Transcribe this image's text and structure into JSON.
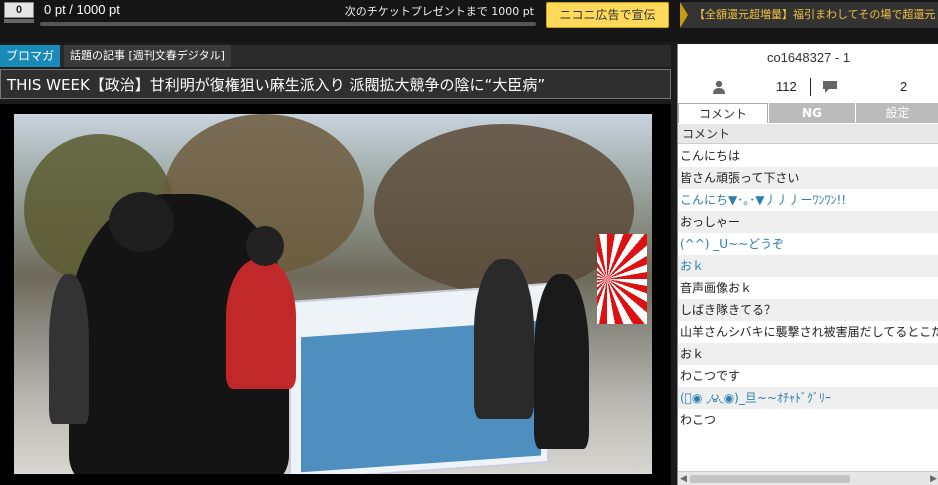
{
  "points": {
    "badge": "0",
    "status": "0 pt / 1000 pt",
    "next_ticket": "次のチケットプレゼントまで 1000 pt",
    "progress": 0
  },
  "ad_button": "ニコニ広告で宣伝",
  "ticker": "【全額還元超増量】福引まわしてその場で超還元",
  "tags": {
    "blomaga": "ブロマガ",
    "category": "話題の記事 [週刊文春デジタル]"
  },
  "title": "THIS WEEK【政治】甘利明が復権狙い麻生派入り 派閥拡大競争の陰に“大臣病”",
  "community": {
    "id": "co1648327 - 1",
    "viewers": "112",
    "comments": "2"
  },
  "tabs": [
    "コメント",
    "NG",
    "設定"
  ],
  "comment_header": "コメント",
  "comments": [
    {
      "text": "こんにちは",
      "color": "#222222"
    },
    {
      "text": "皆さん頑張って下さい",
      "color": "#222222"
    },
    {
      "text": "こんにち▼･｡･▼丿丿丿ーﾜﾝﾜﾝ!!",
      "color": "#2a7fb0"
    },
    {
      "text": "おっしゃー",
      "color": "#222222"
    },
    {
      "text": "(^^) _U~~どうぞ",
      "color": "#2a7fb0"
    },
    {
      "text": "おｋ",
      "color": "#2a7fb0"
    },
    {
      "text": "音声画像おｋ",
      "color": "#222222"
    },
    {
      "text": "しばき隊きてる？",
      "color": "#222222"
    },
    {
      "text": "山羊さんシバキに襲撃され被害届だしてるとこだ",
      "color": "#222222"
    },
    {
      "text": "おｋ",
      "color": "#222222"
    },
    {
      "text": "わこつです",
      "color": "#222222"
    },
    {
      "text": "(ﾟ◉ ◞౪◟◉)_旦~~ｵﾁｬﾄﾞｸﾞﾘｰ",
      "color": "#2a7fb0"
    },
    {
      "text": "わこつ",
      "color": "#222222"
    }
  ],
  "icons": {
    "viewer": "person-icon",
    "comment": "speech-bubble-icon"
  }
}
